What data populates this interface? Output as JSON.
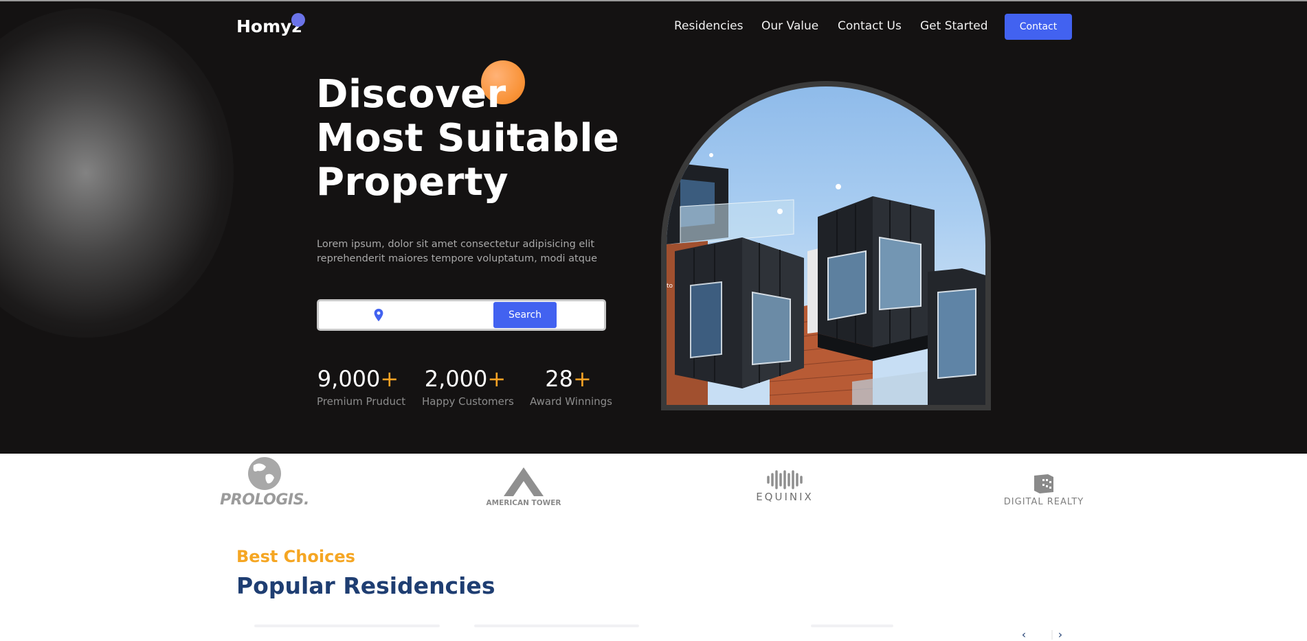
{
  "brand": {
    "name": "Homyz"
  },
  "nav": {
    "links": [
      "Residencies",
      "Our Value",
      "Contact Us",
      "Get Started"
    ],
    "contact_label": "Contact"
  },
  "hero": {
    "title_lines": [
      "Discover",
      "Most Suitable",
      "Property"
    ],
    "description": "Lorem ipsum, dolor sit amet consectetur adipisicing elit reprehenderit maiores tempore voluptatum, modi atque",
    "search": {
      "value": "",
      "button_label": "Search"
    },
    "stats": [
      {
        "value": "9,000",
        "suffix": "+",
        "label": "Premium Pruduct"
      },
      {
        "value": "2,000",
        "suffix": "+",
        "label": "Happy Customers"
      },
      {
        "value": "28",
        "suffix": "+",
        "label": "Award Winnings"
      }
    ],
    "image_overlay_text": "to"
  },
  "companies": [
    "PROLOGIS.",
    "AMERICAN TOWER",
    "EQUINIX",
    "DIGITAL REALTY"
  ],
  "residencies": {
    "subtitle": "Best Choices",
    "title": "Popular Residencies",
    "prev_icon": "‹",
    "next_icon": "›"
  },
  "colors": {
    "accent": "#4262f0",
    "orange": "#f7a224",
    "navy": "#1f3e72",
    "hero_bg": "#141212"
  }
}
